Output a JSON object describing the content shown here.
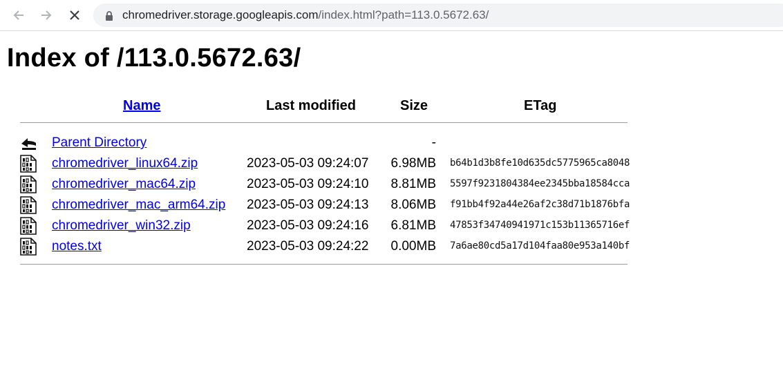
{
  "browser": {
    "url_host": "chromedriver.storage.googleapis.com",
    "url_rest": "/index.html?path=113.0.5672.63/",
    "back_icon": "arrow-left",
    "forward_icon": "arrow-right",
    "stop_icon": "close",
    "lock_icon": "lock"
  },
  "page": {
    "title": "Index of /113.0.5672.63/"
  },
  "table": {
    "headers": {
      "name": "Name",
      "last_modified": "Last modified",
      "size": "Size",
      "etag": "ETag"
    },
    "rows": [
      {
        "icon": "back-folder",
        "name": "Parent Directory",
        "modified": "",
        "size": "-",
        "etag": ""
      },
      {
        "icon": "binary-file",
        "name": "chromedriver_linux64.zip",
        "modified": "2023-05-03 09:24:07",
        "size": "6.98MB",
        "etag": "b64b1d3b8fe10d635dc5775965ca8048"
      },
      {
        "icon": "binary-file",
        "name": "chromedriver_mac64.zip",
        "modified": "2023-05-03 09:24:10",
        "size": "8.81MB",
        "etag": "5597f9231804384ee2345bba18584cca"
      },
      {
        "icon": "binary-file",
        "name": "chromedriver_mac_arm64.zip",
        "modified": "2023-05-03 09:24:13",
        "size": "8.06MB",
        "etag": "f91bb4f92a44e26af2c38d71b1876bfa"
      },
      {
        "icon": "binary-file",
        "name": "chromedriver_win32.zip",
        "modified": "2023-05-03 09:24:16",
        "size": "6.81MB",
        "etag": "47853f34740941971c153b11365716ef"
      },
      {
        "icon": "binary-file",
        "name": "notes.txt",
        "modified": "2023-05-03 09:24:22",
        "size": "0.00MB",
        "etag": "7a6ae80cd5a17d104faa80e953a140bf"
      }
    ]
  },
  "colors": {
    "link": "#0000ee",
    "omnibox_bg": "#f1f3f4",
    "rule": "#9a9a9a"
  }
}
